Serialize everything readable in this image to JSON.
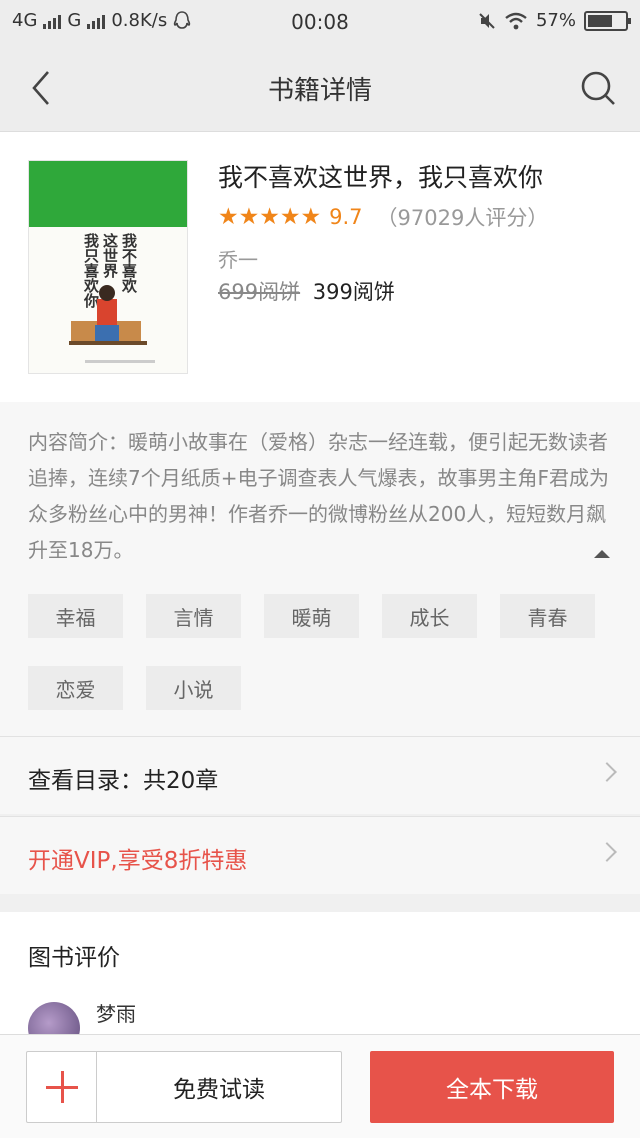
{
  "status_bar": {
    "network1": "4G",
    "network2": "G",
    "speed": "0.8K/s",
    "time": "00:08",
    "battery": "57%"
  },
  "nav": {
    "title": "书籍详情"
  },
  "book": {
    "title": "我不喜欢这世界，我只喜欢你",
    "stars": "★★★★★",
    "score": "9.7",
    "rating_count": "（97029人评分）",
    "author": "乔一",
    "old_price": "699阅饼",
    "new_price": "399阅饼",
    "cover_title_col1": "我不喜欢",
    "cover_title_col2": "这世界",
    "cover_title_col3": "我只喜欢你"
  },
  "intro": {
    "text": "内容简介：暖萌小故事在（爱格）杂志一经连载，便引起无数读者追捧，连续7个月纸质+电子调查表人气爆表，故事男主角F君成为众多粉丝心中的男神！作者乔一的微博粉丝从200人，短短数月飙升至18万。"
  },
  "tags": [
    "幸福",
    "言情",
    "暖萌",
    "成长",
    "青春",
    "恋爱",
    "小说"
  ],
  "catalog": {
    "label": "查看目录：共20章"
  },
  "vip": {
    "label": "开通VIP,享受8折特惠"
  },
  "reviews": {
    "title": "图书评价",
    "first_reviewer": "梦雨"
  },
  "bottom": {
    "trial_label": "免费试读",
    "download_label": "全本下载"
  },
  "colors": {
    "accent": "#e7534a",
    "star": "#f08519",
    "cover_green": "#2fa83a"
  }
}
